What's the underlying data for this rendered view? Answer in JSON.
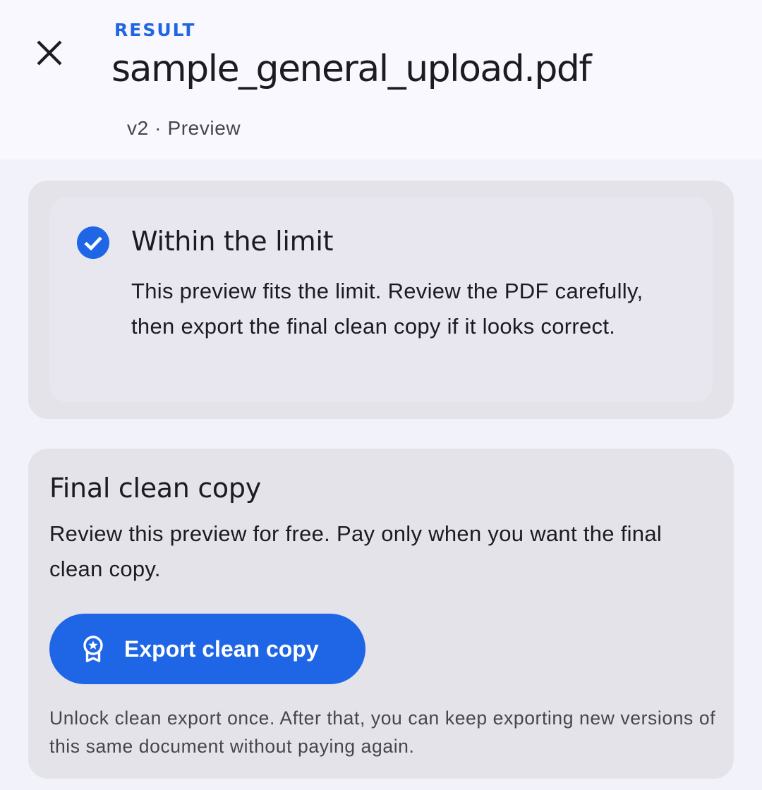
{
  "app_bar": {
    "close_icon": "close-icon",
    "eyebrow": "RESULT",
    "file_name": "sample_general_upload.pdf",
    "meta": "v2 · Preview"
  },
  "status_card": {
    "icon": "check-circle-icon",
    "title": "Within the limit",
    "body": "This preview fits the limit. Review the PDF carefully, then export the final clean copy if it looks correct."
  },
  "export_card": {
    "title": "Final clean copy",
    "body": "Review this preview for free. Pay only when you want the final clean copy.",
    "button_label": "Export clean copy",
    "button_icon": "award-icon",
    "note": "Unlock clean export once. After that, you can keep exporting new versions of this same document without paying again."
  },
  "colors": {
    "accent": "#1f66e6",
    "eyebrow": "#1f66e0",
    "card_bg": "#e3e3e9",
    "page_bg": "#f2f2fb"
  }
}
